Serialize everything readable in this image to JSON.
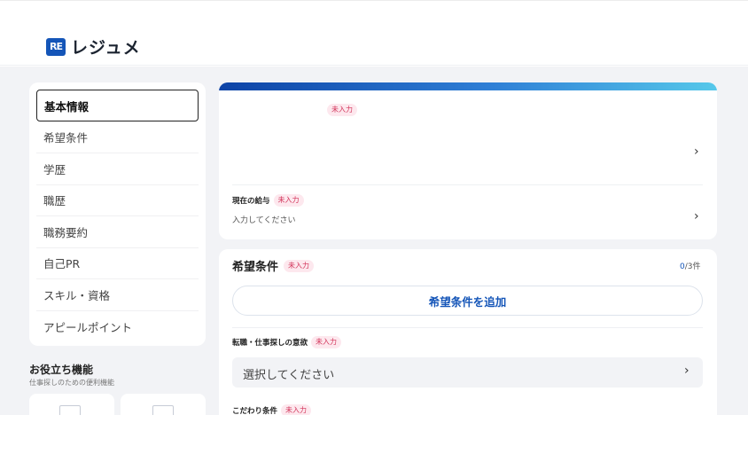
{
  "header": {
    "logo_mark": "RE",
    "logo_text": "レジュメ"
  },
  "sidebar": {
    "items": [
      {
        "label": "基本情報",
        "active": true
      },
      {
        "label": "希望条件"
      },
      {
        "label": "学歴"
      },
      {
        "label": "職歴"
      },
      {
        "label": "職務要約"
      },
      {
        "label": "自己PR"
      },
      {
        "label": "スキル・資格"
      },
      {
        "label": "アピールポイント"
      }
    ]
  },
  "tools": {
    "title": "お役立ち機能",
    "subtitle": "仕事探しのための便利機能"
  },
  "basic_info": {
    "status_badge": "未入力",
    "salary_label": "現在の給与",
    "salary_badge": "未入力",
    "salary_placeholder": "入力してください"
  },
  "preferences": {
    "title": "希望条件",
    "badge": "未入力",
    "count_current": "0",
    "count_suffix": "/3件",
    "add_button": "希望条件を追加",
    "motivation_label": "転職・仕事探しの意欲",
    "motivation_badge": "未入力",
    "motivation_select": "選択してください",
    "conditions_label": "こだわり条件",
    "conditions_badge": "未入力"
  },
  "colors": {
    "brand": "#1455b8",
    "badge_text": "#d2345a",
    "badge_bg": "#fde8ee"
  },
  "icons": {
    "chevron": "›"
  }
}
